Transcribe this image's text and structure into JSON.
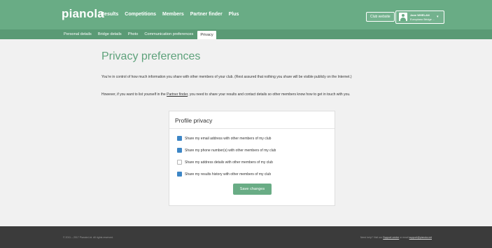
{
  "brand": "pianola",
  "nav": {
    "items": [
      "Results",
      "Competitions",
      "Members",
      "Partner finder",
      "Plus"
    ]
  },
  "header": {
    "club_website": "Club website",
    "user_name": "Jane WHELAN",
    "user_org": "Europiano Bridge ...",
    "caret": "▾"
  },
  "subnav": {
    "tabs": [
      "Personal details",
      "Bridge details",
      "Photo",
      "Communication preferences",
      "Privacy"
    ],
    "active": "Privacy"
  },
  "page": {
    "title": "Privacy preferences",
    "intro": "You’re in control of how much information you share with other members of your club. (Rest assured that nothing you share will be visible publicly on the Internet.)",
    "partner_before": "However, if you want to list yourself in the ",
    "partner_link": "Partner finder",
    "partner_after": ", you need to share your results and contact details so other members know how to get in touch with you."
  },
  "card": {
    "title": "Profile privacy",
    "options": [
      {
        "label": "Share my email address with other members of my club",
        "checked": true
      },
      {
        "label": "Share my phone number(s) with other members of my club",
        "checked": true
      },
      {
        "label": "Share my address details with other members of my club",
        "checked": false
      },
      {
        "label": "Share my results history with other members of my club",
        "checked": true
      }
    ],
    "save_label": "Save changes"
  },
  "footer": {
    "copyright": "© 2011 – 2017 Pianola Ltd. All rights reserved.",
    "help_prefix": "Need help? Visit our ",
    "help_link": "Support centre",
    "help_mid": " or email ",
    "help_email": "support@pianola.net"
  },
  "colors": {
    "accent": "#69ac85",
    "subnav": "#5a9a75",
    "title": "#5ea27b",
    "checkbox": "#3d86c6",
    "footer": "#3b3b3b"
  }
}
